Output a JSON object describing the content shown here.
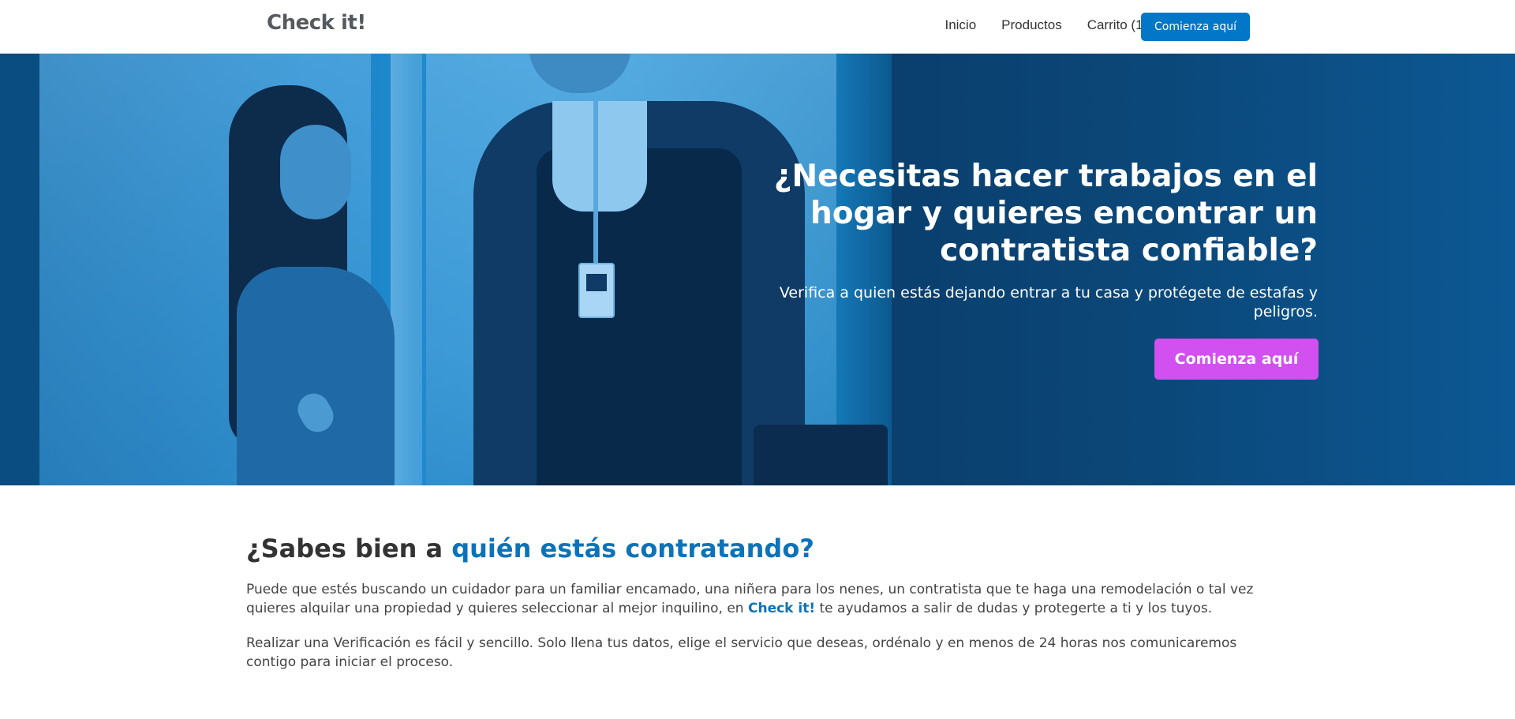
{
  "header": {
    "logo": "Check it!",
    "nav": [
      "Inicio",
      "Productos",
      "Carrito (1 Item)"
    ],
    "cta": "Comienza aquí"
  },
  "hero": {
    "title": "¿Necesitas hacer trabajos en el hogar y quieres encontrar un contratista confiable?",
    "subtitle": "Verifica a quien estás dejando entrar a tu casa y protégete de estafas y peligros.",
    "cta": "Comienza aquí",
    "slides_total": 4,
    "active_slide": 2
  },
  "section": {
    "title_prefix": "¿Sabes bien a ",
    "title_accent": "quién estás contratando?",
    "para1_before": "Puede que estés buscando un cuidador para un familiar encamado, una niñera para los nenes, un contratista que te haga una remodelación o tal vez quieres alquilar una propiedad y quieres seleccionar al mejor inquilino, en ",
    "para1_brand": "Check it!",
    "para1_after": " te ayudamos a salir de dudas y protegerte a ti y los tuyos.",
    "para2": "Realizar una Verificación es fácil y sencillo. Solo llena tus datos, elige el servicio que deseas, ordénalo y en menos de 24 horas nos comunicaremos contigo para iniciar el proceso."
  },
  "colors": {
    "brand_blue": "#0277c7",
    "accent_blue": "#0d73b8",
    "hero_cta": "#d24ff0",
    "active_dot": "#b06ae0"
  }
}
